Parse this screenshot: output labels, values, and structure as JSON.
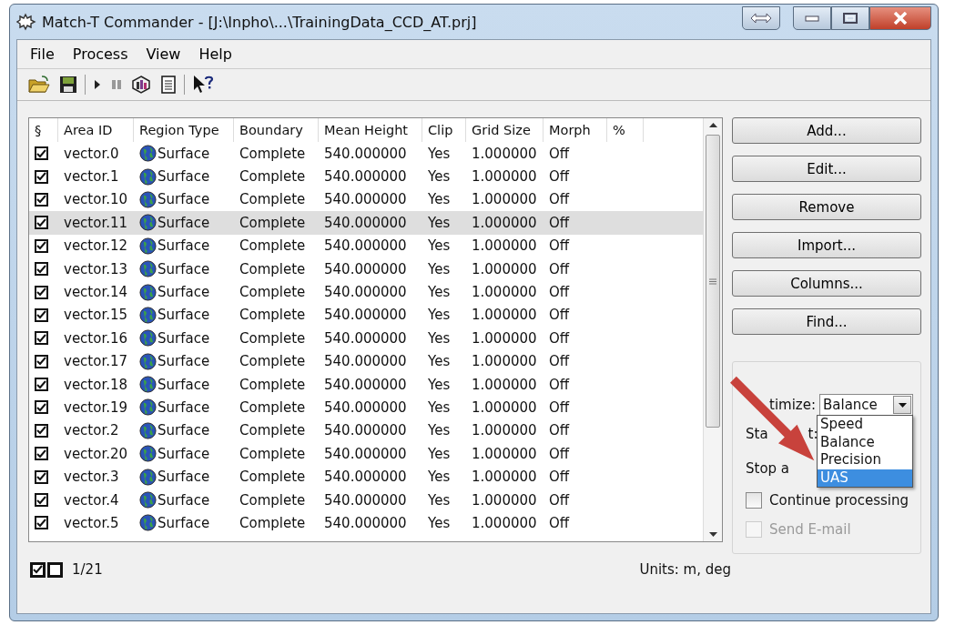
{
  "window": {
    "title": "Match-T Commander - [J:\\Inpho\\...\\TrainingData_CCD_AT.prj]"
  },
  "menu": [
    "File",
    "Process",
    "View",
    "Help"
  ],
  "toolbar": [
    {
      "kind": "open"
    },
    {
      "kind": "save"
    },
    {
      "kind": "sep"
    },
    {
      "kind": "play"
    },
    {
      "kind": "pause"
    },
    {
      "kind": "chart"
    },
    {
      "kind": "list"
    },
    {
      "kind": "sep"
    },
    {
      "kind": "help"
    }
  ],
  "table": {
    "check_header": "§",
    "columns": [
      "Area ID",
      "Region Type",
      "Boundary",
      "Mean Height",
      "Clip",
      "Grid Size",
      "Morph",
      "%"
    ],
    "rows": [
      {
        "checked": true,
        "selected": false,
        "cells": [
          "vector.0",
          "Surface",
          "Complete",
          "540.000000",
          "Yes",
          "1.000000",
          "Off"
        ]
      },
      {
        "checked": true,
        "selected": false,
        "cells": [
          "vector.1",
          "Surface",
          "Complete",
          "540.000000",
          "Yes",
          "1.000000",
          "Off"
        ]
      },
      {
        "checked": true,
        "selected": false,
        "cells": [
          "vector.10",
          "Surface",
          "Complete",
          "540.000000",
          "Yes",
          "1.000000",
          "Off"
        ]
      },
      {
        "checked": true,
        "selected": true,
        "cells": [
          "vector.11",
          "Surface",
          "Complete",
          "540.000000",
          "Yes",
          "1.000000",
          "Off"
        ]
      },
      {
        "checked": true,
        "selected": false,
        "cells": [
          "vector.12",
          "Surface",
          "Complete",
          "540.000000",
          "Yes",
          "1.000000",
          "Off"
        ]
      },
      {
        "checked": true,
        "selected": false,
        "cells": [
          "vector.13",
          "Surface",
          "Complete",
          "540.000000",
          "Yes",
          "1.000000",
          "Off"
        ]
      },
      {
        "checked": true,
        "selected": false,
        "cells": [
          "vector.14",
          "Surface",
          "Complete",
          "540.000000",
          "Yes",
          "1.000000",
          "Off"
        ]
      },
      {
        "checked": true,
        "selected": false,
        "cells": [
          "vector.15",
          "Surface",
          "Complete",
          "540.000000",
          "Yes",
          "1.000000",
          "Off"
        ]
      },
      {
        "checked": true,
        "selected": false,
        "cells": [
          "vector.16",
          "Surface",
          "Complete",
          "540.000000",
          "Yes",
          "1.000000",
          "Off"
        ]
      },
      {
        "checked": true,
        "selected": false,
        "cells": [
          "vector.17",
          "Surface",
          "Complete",
          "540.000000",
          "Yes",
          "1.000000",
          "Off"
        ]
      },
      {
        "checked": true,
        "selected": false,
        "cells": [
          "vector.18",
          "Surface",
          "Complete",
          "540.000000",
          "Yes",
          "1.000000",
          "Off"
        ]
      },
      {
        "checked": true,
        "selected": false,
        "cells": [
          "vector.19",
          "Surface",
          "Complete",
          "540.000000",
          "Yes",
          "1.000000",
          "Off"
        ]
      },
      {
        "checked": true,
        "selected": false,
        "cells": [
          "vector.2",
          "Surface",
          "Complete",
          "540.000000",
          "Yes",
          "1.000000",
          "Off"
        ]
      },
      {
        "checked": true,
        "selected": false,
        "cells": [
          "vector.20",
          "Surface",
          "Complete",
          "540.000000",
          "Yes",
          "1.000000",
          "Off"
        ]
      },
      {
        "checked": true,
        "selected": false,
        "cells": [
          "vector.3",
          "Surface",
          "Complete",
          "540.000000",
          "Yes",
          "1.000000",
          "Off"
        ]
      },
      {
        "checked": true,
        "selected": false,
        "cells": [
          "vector.4",
          "Surface",
          "Complete",
          "540.000000",
          "Yes",
          "1.000000",
          "Off"
        ]
      },
      {
        "checked": true,
        "selected": false,
        "cells": [
          "vector.5",
          "Surface",
          "Complete",
          "540.000000",
          "Yes",
          "1.000000",
          "Off"
        ]
      }
    ]
  },
  "buttons": [
    "Add...",
    "Edit...",
    "Remove",
    "Import...",
    "Columns...",
    "Find..."
  ],
  "options": {
    "optimize_label": "timize:",
    "optimize_value": "Balance",
    "dropdown": [
      {
        "label": "Speed",
        "selected": false
      },
      {
        "label": "Balance",
        "selected": false
      },
      {
        "label": "Precision",
        "selected": false
      },
      {
        "label": "UAS",
        "selected": true
      }
    ],
    "start_label_parts": [
      "Sta",
      "t:"
    ],
    "stop_label": "Stop a",
    "checkboxes": [
      {
        "label": "Continue processing",
        "checked": false,
        "disabled": false
      },
      {
        "label": "Send E-mail",
        "checked": false,
        "disabled": true
      }
    ]
  },
  "status": {
    "count": "1/21",
    "units": "Units: m, deg"
  }
}
